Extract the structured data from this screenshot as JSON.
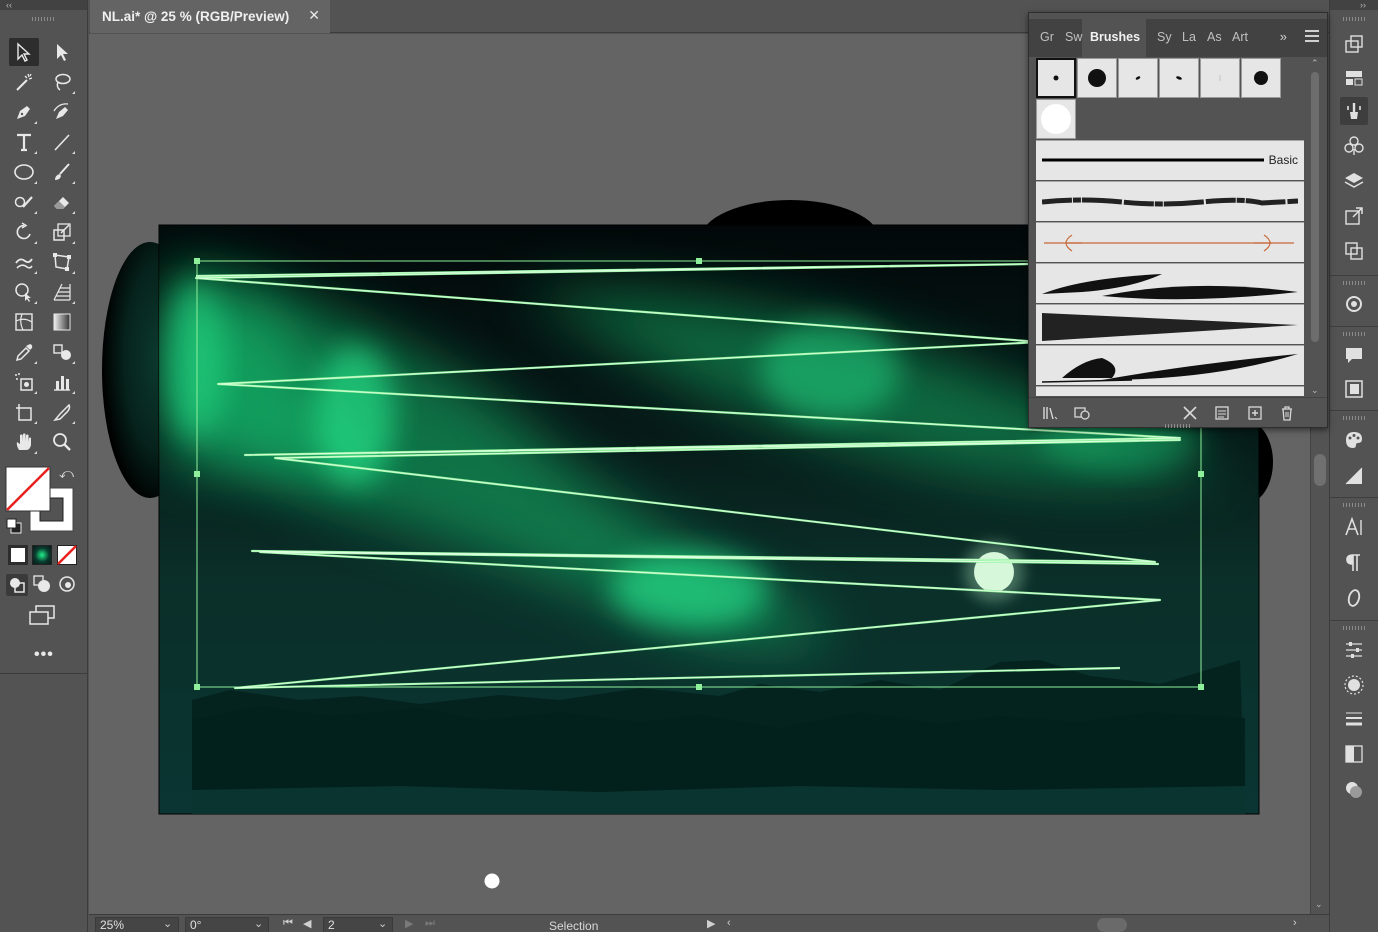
{
  "document": {
    "tab_title": "NL.ai* @ 25 % (RGB/Preview)",
    "close_glyph": "✕"
  },
  "status_bar": {
    "zoom": "25%",
    "rotation": "0°",
    "artboard_number": "2",
    "current_tool": "Selection"
  },
  "brushes_panel": {
    "tabs": [
      {
        "label": "Gr",
        "active": false
      },
      {
        "label": "Sw",
        "active": false
      },
      {
        "label": "Brushes",
        "active": true
      },
      {
        "label": "Sy",
        "active": false
      },
      {
        "label": "La",
        "active": false
      },
      {
        "label": "As",
        "active": false
      },
      {
        "label": "Art",
        "active": false
      }
    ],
    "more_glyph": "»",
    "basic_label": "Basic"
  },
  "left_tools": [
    "selection-tool",
    "direct-selection-tool",
    "magic-wand-tool",
    "lasso-tool",
    "pen-tool",
    "curvature-tool",
    "type-tool",
    "line-segment-tool",
    "ellipse-tool",
    "paintbrush-tool",
    "shaper-tool",
    "eraser-tool",
    "rotate-tool",
    "scale-tool",
    "warp-tool",
    "free-transform-tool",
    "shape-builder-tool",
    "perspective-grid-tool",
    "mesh-tool",
    "gradient-tool",
    "eyedropper-tool",
    "blend-tool",
    "symbol-sprayer-tool",
    "column-graph-tool",
    "artboard-tool",
    "slice-tool",
    "hand-tool",
    "zoom-tool"
  ],
  "right_dock_icons": [
    "transform-icon",
    "align-icon",
    "brushes-icon",
    "symbols-icon",
    "layers-icon",
    "export-icon",
    "pathfinder-icon",
    "recolor-icon",
    "comments-icon",
    "libraries-icon",
    "color-guide-icon",
    "gradient-panel-icon",
    "character-icon",
    "paragraph-icon",
    "opentype-icon",
    "properties-icon",
    "appearance-icon",
    "stroke-icon",
    "transparency-icon",
    "graphic-styles-icon"
  ],
  "colors": {
    "ui_bg": "#535353",
    "canvas_bg": "#646464",
    "aurora_green": "#1ef08a",
    "selection_green": "#8ef09a"
  }
}
